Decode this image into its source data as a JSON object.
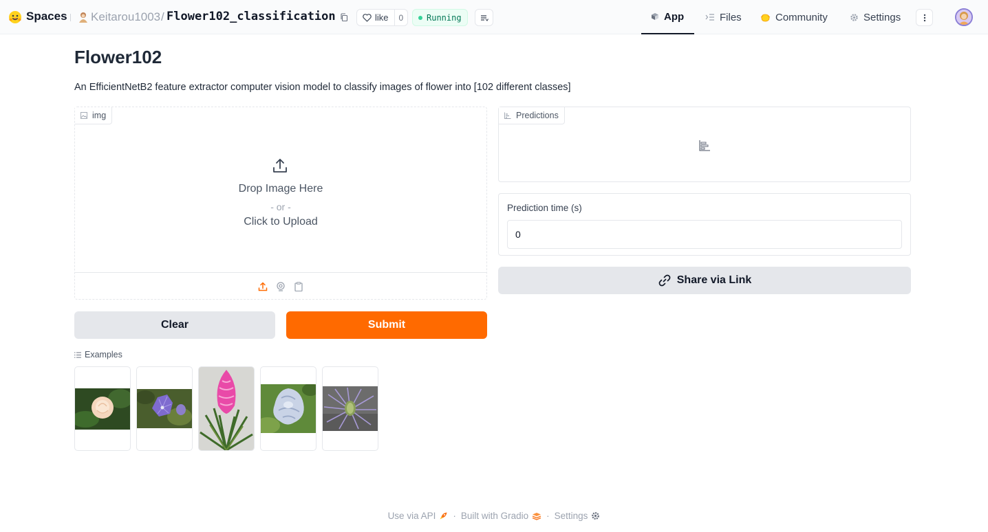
{
  "topbar": {
    "brand": "Spaces",
    "owner": "Keitarou1003",
    "slash": "/",
    "repo": "Flower102_classification",
    "like_label": "like",
    "like_count": "0",
    "status": "Running",
    "tabs": [
      {
        "label": "App",
        "icon": "cube-icon",
        "active": true
      },
      {
        "label": "Files",
        "icon": "files-icon",
        "active": false
      },
      {
        "label": "Community",
        "icon": "community-icon",
        "active": false
      },
      {
        "label": "Settings",
        "icon": "gear-icon",
        "active": false
      }
    ]
  },
  "main": {
    "title": "Flower102",
    "description": "An EfficientNetB2 feature extractor computer vision model to classify images of flower into [102 different classes]"
  },
  "image_input": {
    "label": "img",
    "drop_text": "Drop Image Here",
    "or_text": "- or -",
    "click_text": "Click to Upload",
    "sources": [
      "upload-icon",
      "webcam-icon",
      "clipboard-icon"
    ]
  },
  "predictions": {
    "label": "Predictions"
  },
  "prediction_time": {
    "label": "Prediction time (s)",
    "value": "0"
  },
  "buttons": {
    "share": "Share via Link",
    "clear": "Clear",
    "submit": "Submit"
  },
  "examples": {
    "label": "Examples",
    "items": [
      "peach-rose",
      "balloon-flower",
      "pink-bromeliad",
      "bearded-iris",
      "sea-holly"
    ]
  },
  "footer": {
    "api": "Use via API",
    "dot1": "·",
    "gradio": "Built with Gradio",
    "dot2": "·",
    "settings": "Settings"
  },
  "colors": {
    "accent": "#ff6a00",
    "running_green": "#047857",
    "button_gray": "#e5e7eb"
  }
}
